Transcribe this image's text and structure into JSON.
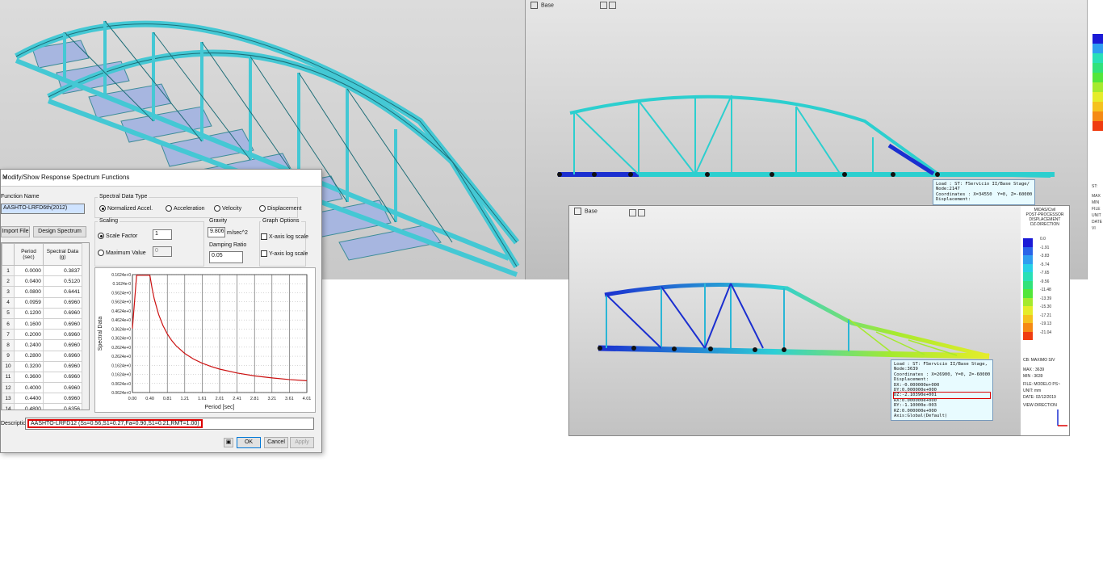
{
  "views": {
    "top_right_title": "Base",
    "bottom_right_title": "Base"
  },
  "tooltip1": {
    "lines": [
      "Load : ST: FServicio II/Base Stage/",
      "Node:2147",
      "Coordinates : X=34550  Y=0, Z=-60000",
      "Displacement:"
    ]
  },
  "tooltip2": {
    "lines": [
      "Load : ST: FServicio II/Base Stage,",
      "Node:3639",
      "Coordinates : X=26900, Y=0, Z=-60000",
      "Displacement:",
      "DX:-0.000000e+000",
      "DY:0.000000e+000",
      "DZ:-2.10390e+001",
      "RX:0.000000e+000",
      "RY:-1.10000e-003",
      "RZ:0.000000e+000",
      "Axis:Global(Default)"
    ],
    "highlight_index": 6
  },
  "legend2": {
    "header": [
      "MIDAS/Civil",
      "POST-PROCESSOR",
      "DISPLACEMENT",
      "DZ-DIRECTION"
    ],
    "values": [
      "0.0",
      "-1.91",
      "-3.83",
      "-5.74",
      "-7.65",
      "-9.56",
      "-11.48",
      "-13.39",
      "-15.30",
      "-17.21",
      "-19.13",
      "-21.04"
    ],
    "colors": [
      "#1b1bd6",
      "#2a64e8",
      "#2f9ef0",
      "#28d0e6",
      "#29e0b6",
      "#31e27a",
      "#53e63a",
      "#a5ea2e",
      "#e5ec2a",
      "#f5c21e",
      "#f58a14",
      "#ef3c10"
    ],
    "info": [
      "CB: MAXIMO SIV",
      "MAX : 3639",
      "MIN : 3639",
      "FILE: MODELO PS~",
      "UNIT: mm",
      "DATE: 02/12/2019",
      "VIEW-DIRECTION"
    ]
  },
  "rstrip": {
    "labels": [
      "ST:",
      "MAX",
      "MIN",
      "FILE",
      "UNIT",
      "DATE",
      "VI"
    ]
  },
  "dialog": {
    "title": "Modify/Show Response Spectrum Functions",
    "close": "✕",
    "function_name_label": "Function Name",
    "function_name": "AASHTO-LRFD6th(2012)",
    "spectral_type_label": "Spectral Data Type",
    "types": [
      "Normalized Accel.",
      "Acceleration",
      "Velocity",
      "Displacement"
    ],
    "import_button": "Import File",
    "design_button": "Design Spectrum",
    "scaling_label": "Scaling",
    "scale_factor_label": "Scale Factor",
    "scale_factor": "1",
    "max_value_label": "Maximum Value",
    "max_value": "0",
    "gravity_label": "Gravity",
    "gravity": "9.806",
    "gravity_unit": "m/sec^2",
    "damping_label": "Damping Ratio",
    "damping": "0.05",
    "graph_label": "Graph Options",
    "xlog": "X-axis log scale",
    "ylog": "Y-axis log scale",
    "col_period": "Period (sec)",
    "col_spectral": "Spectral Data (g)",
    "rows": [
      [
        "1",
        "0.0000",
        "0.3837"
      ],
      [
        "2",
        "0.0400",
        "0.5120"
      ],
      [
        "3",
        "0.0800",
        "0.6441"
      ],
      [
        "4",
        "0.0959",
        "0.6960"
      ],
      [
        "5",
        "0.1200",
        "0.6960"
      ],
      [
        "6",
        "0.1600",
        "0.6960"
      ],
      [
        "7",
        "0.2000",
        "0.6960"
      ],
      [
        "8",
        "0.2400",
        "0.6960"
      ],
      [
        "9",
        "0.2800",
        "0.6960"
      ],
      [
        "10",
        "0.3200",
        "0.6960"
      ],
      [
        "11",
        "0.3600",
        "0.6960"
      ],
      [
        "12",
        "0.4000",
        "0.6960"
      ],
      [
        "13",
        "0.4400",
        "0.6960"
      ],
      [
        "14",
        "0.4800",
        "0.6356"
      ]
    ],
    "description_label": "Description",
    "description": "AASHTO-LRFD12 (Ss=0.56,S1=0.27,Fa=0.90,S1=0.21,RMT=1.00)",
    "ok": "OK",
    "cancel": "Cancel",
    "apply": "Apply"
  },
  "chart_data": {
    "type": "line",
    "xlabel": "Period [sec]",
    "ylabel": "Spectral Data",
    "xlim": [
      0,
      4.0
    ],
    "ylim": [
      0,
      0.7
    ],
    "x_ticks": [
      "0.00",
      "0.40",
      "0.81",
      "1.21",
      "1.61",
      "2.01",
      "2.41",
      "2.81",
      "3.21",
      "3.61",
      "4.01"
    ],
    "y_ticks": [
      "0.1624e+0",
      "0.1624e-0",
      "0.5624e+0",
      "0.5624e+0",
      "0.4624e+0",
      "0.4624e+0",
      "0.3624e+0",
      "0.3624e+0",
      "0.2624e+0",
      "0.2624e+0",
      "0.1624e+0",
      "0.1624e+0",
      "0.0624e+0",
      "0.0624e+0"
    ],
    "series": [
      {
        "color": "#cc1111",
        "x": [
          0,
          0.096,
          0.4,
          0.45,
          0.5,
          0.6,
          0.7,
          0.8,
          0.9,
          1.0,
          1.2,
          1.4,
          1.6,
          1.8,
          2.0,
          2.4,
          2.8,
          3.2,
          3.6,
          4.0
        ],
        "y": [
          0.38,
          0.696,
          0.696,
          0.62,
          0.557,
          0.464,
          0.398,
          0.348,
          0.309,
          0.278,
          0.232,
          0.199,
          0.174,
          0.155,
          0.139,
          0.116,
          0.099,
          0.087,
          0.077,
          0.07
        ]
      }
    ]
  }
}
